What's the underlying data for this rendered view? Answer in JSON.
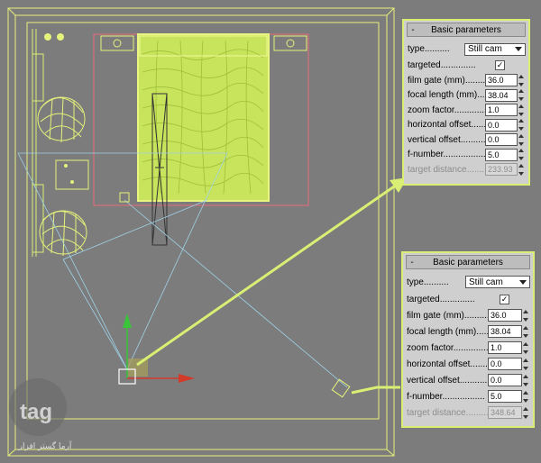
{
  "viewport": {
    "watermark_text": "آرما گستر افزار",
    "logo_text": "tag"
  },
  "panel_top": {
    "header": "Basic parameters",
    "collapse_symbol": "-",
    "type_label": "type",
    "type_value": "Still cam",
    "targeted_label": "targeted",
    "targeted_checked": true,
    "rows": [
      {
        "label": "film gate (mm)",
        "value": "36.0",
        "disabled": false
      },
      {
        "label": "focal length (mm)",
        "value": "38.04",
        "disabled": false
      },
      {
        "label": "zoom factor",
        "value": "1.0",
        "disabled": false
      },
      {
        "label": "horizontal offset",
        "value": "0.0",
        "disabled": false
      },
      {
        "label": "vertical offset",
        "value": "0.0",
        "disabled": false
      },
      {
        "label": "f-number",
        "value": "5.0",
        "disabled": false
      },
      {
        "label": "target distance",
        "value": "233.93",
        "disabled": true
      }
    ]
  },
  "panel_bottom": {
    "header": "Basic parameters",
    "collapse_symbol": "-",
    "type_label": "type",
    "type_value": "Still cam",
    "targeted_label": "targeted",
    "targeted_checked": true,
    "rows": [
      {
        "label": "film gate (mm)",
        "value": "36.0",
        "disabled": false
      },
      {
        "label": "focal length (mm)",
        "value": "38.04",
        "disabled": false
      },
      {
        "label": "zoom factor",
        "value": "1.0",
        "disabled": false
      },
      {
        "label": "horizontal offset",
        "value": "0.0",
        "disabled": false
      },
      {
        "label": "vertical offset",
        "value": "0.0",
        "disabled": false
      },
      {
        "label": "f-number",
        "value": "5.0",
        "disabled": false
      },
      {
        "label": "target distance",
        "value": "348.64",
        "disabled": true
      }
    ]
  },
  "colors": {
    "viewport_bg": "#7c7c7c",
    "highlight": "#d9ef74",
    "room_outline": "#e8f07a",
    "camera_cone": "#9fd2e8"
  }
}
